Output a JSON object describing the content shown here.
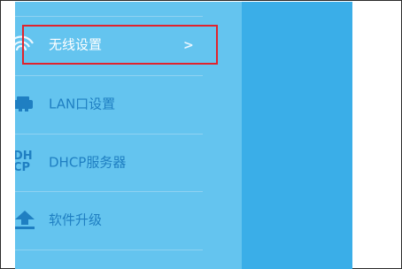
{
  "menu": {
    "items": [
      {
        "label": "无线设置",
        "chevron": ">",
        "icon": "wifi-icon"
      },
      {
        "label": "LAN口设置",
        "icon": "lan-icon"
      },
      {
        "label": "DHCP服务器",
        "icon": "dhcp-icon",
        "icon_text": "DHCP"
      },
      {
        "label": "软件升级",
        "icon": "upload-icon"
      }
    ]
  },
  "colors": {
    "menu_bg": "#64c4ef",
    "right_panel_bg": "#3aaee8",
    "label_text": "#ffffff",
    "dim_text": "#1f7fc2",
    "highlight": "#e0232d"
  }
}
